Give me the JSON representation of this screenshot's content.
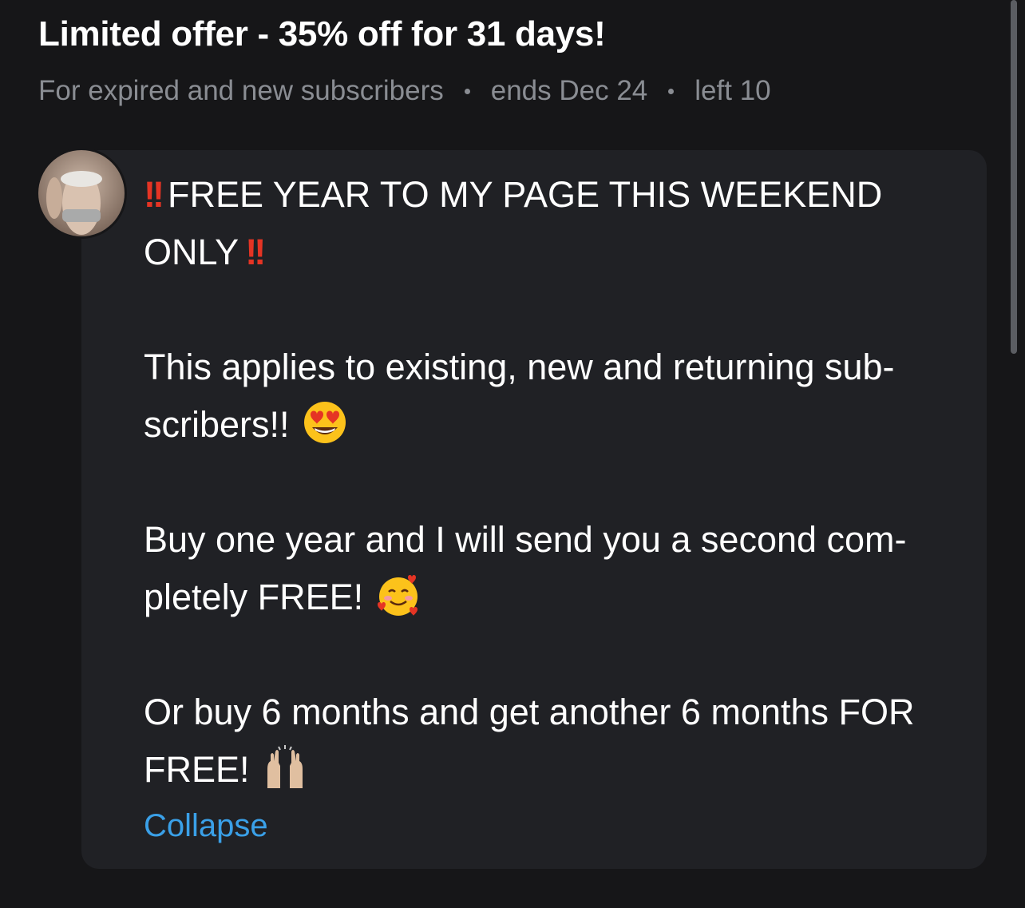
{
  "offer": {
    "title": "Limited offer - 35% off for 31 days!",
    "audience": "For expired and new subscribers",
    "ends": "ends Dec 24",
    "left": "left 10"
  },
  "post": {
    "headline_a": "FREE YEAR TO MY PAGE THIS WEEKEND ONLY",
    "double_exclamation": "!!",
    "para1": "This applies to existing, new and returning sub-scribers!!",
    "para2": "Buy one year and I will send you a second com-pletely FREE!",
    "para3": "Or buy 6 months and get another 6 months FOR FREE!",
    "collapse_label": "Collapse"
  },
  "icons": {
    "avatar": "avatar-photo",
    "emoji1": "heart-eyes-emoji",
    "emoji2": "smiling-face-with-hearts-emoji",
    "emoji3": "raising-hands-emoji"
  },
  "colors": {
    "background": "#161618",
    "bubble": "#202125",
    "accent_link": "#3aa0e8",
    "exclamation": "#e53424",
    "muted_text": "#8a8d93"
  }
}
